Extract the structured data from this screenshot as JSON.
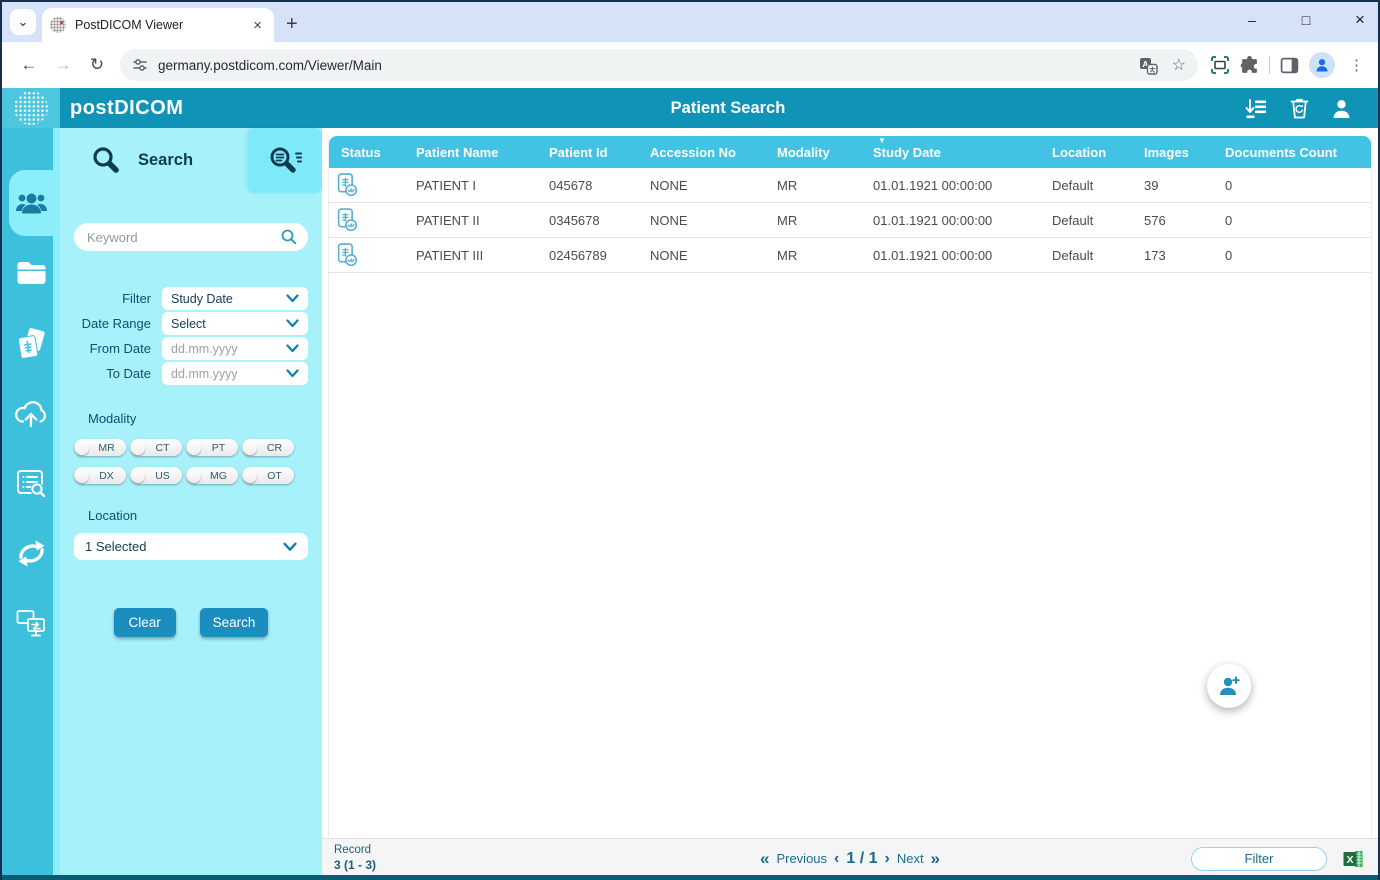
{
  "browser": {
    "tab_title": "PostDICOM Viewer",
    "url": "germany.postdicom.com/Viewer/Main"
  },
  "header": {
    "brand": "postDICOM",
    "title": "Patient Search"
  },
  "search_panel": {
    "tab_label": "Search",
    "keyword_placeholder": "Keyword",
    "filter_rows": [
      {
        "label": "Filter",
        "value": "Study Date"
      },
      {
        "label": "Date Range",
        "value": "Select"
      },
      {
        "label": "From Date",
        "value": "dd.mm.yyyy"
      },
      {
        "label": "To Date",
        "value": "dd.mm.yyyy"
      }
    ],
    "modality_label": "Modality",
    "modalities": [
      "MR",
      "CT",
      "PT",
      "CR",
      "DX",
      "US",
      "MG",
      "OT"
    ],
    "location_label": "Location",
    "location_value": "1 Selected",
    "clear_button": "Clear",
    "search_button": "Search"
  },
  "table": {
    "columns": [
      "Status",
      "Patient Name",
      "Patient Id",
      "Accession No",
      "Modality",
      "Study Date",
      "Location",
      "Images",
      "Documents Count"
    ],
    "sort_column": "Study Date",
    "rows": [
      {
        "name": "PATIENT I",
        "id": "045678",
        "accession": "NONE",
        "modality": "MR",
        "study_date": "01.01.1921 00:00:00",
        "location": "Default",
        "images": "39",
        "documents": "0"
      },
      {
        "name": "PATIENT II",
        "id": "0345678",
        "accession": "NONE",
        "modality": "MR",
        "study_date": "01.01.1921 00:00:00",
        "location": "Default",
        "images": "576",
        "documents": "0"
      },
      {
        "name": "PATIENT III",
        "id": "02456789",
        "accession": "NONE",
        "modality": "MR",
        "study_date": "01.01.1921 00:00:00",
        "location": "Default",
        "images": "173",
        "documents": "0"
      }
    ]
  },
  "footer": {
    "record_label": "Record",
    "record_value": "3 (1 - 3)",
    "previous": "Previous",
    "page": "1 / 1",
    "next": "Next",
    "filter_button": "Filter"
  },
  "icons": {
    "tab_caret": "⌄",
    "tab_close": "×",
    "new_tab": "+",
    "minimize": "–",
    "maximize": "□",
    "close": "×",
    "back": "←",
    "forward": "→",
    "reload": "↻",
    "bookmark_star": "☆",
    "overflow_menu": "⋮",
    "sort_caret": "▼",
    "prev_double": "«",
    "prev_single": "‹",
    "next_single": "›",
    "next_double": "»"
  },
  "colors": {
    "header_teal": "#0f93b7",
    "sidebar_teal": "#3cc0dc",
    "panel_cyan": "#a7f1fb",
    "highlight_cyan": "#8deefb",
    "table_header_cyan": "#42c3e4",
    "button_blue": "#1c8dbf",
    "dark_text": "#0d4f6e",
    "footer_text": "#1b6a8e",
    "excel_green": "#1d6f42"
  }
}
